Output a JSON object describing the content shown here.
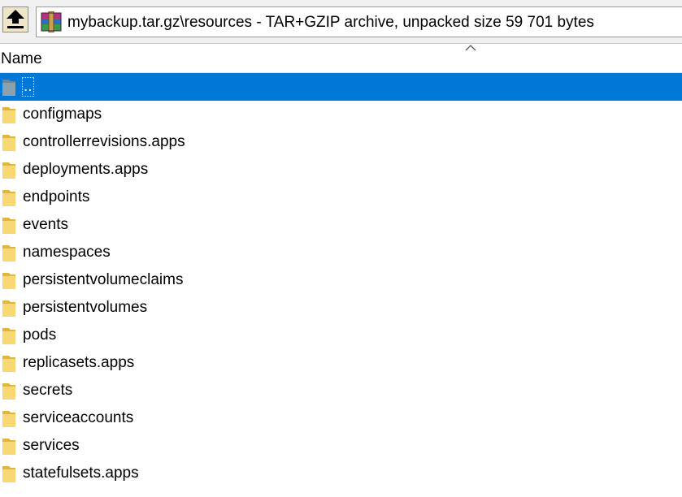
{
  "address_bar": {
    "path_text": "mybackup.tar.gz\\resources - TAR+GZIP archive, unpacked size 59 701 bytes",
    "up_icon": "up-arrow-icon",
    "archive_icon": "winrar-archive-icon"
  },
  "columns": {
    "name_label": "Name",
    "sort_icon": "sort-ascending-caret-icon"
  },
  "items": [
    {
      "label": "..",
      "icon": "parent-folder-icon",
      "selected": true
    },
    {
      "label": "configmaps",
      "icon": "folder-icon",
      "selected": false
    },
    {
      "label": "controllerrevisions.apps",
      "icon": "folder-icon",
      "selected": false
    },
    {
      "label": "deployments.apps",
      "icon": "folder-icon",
      "selected": false
    },
    {
      "label": "endpoints",
      "icon": "folder-icon",
      "selected": false
    },
    {
      "label": "events",
      "icon": "folder-icon",
      "selected": false
    },
    {
      "label": "namespaces",
      "icon": "folder-icon",
      "selected": false
    },
    {
      "label": "persistentvolumeclaims",
      "icon": "folder-icon",
      "selected": false
    },
    {
      "label": "persistentvolumes",
      "icon": "folder-icon",
      "selected": false
    },
    {
      "label": "pods",
      "icon": "folder-icon",
      "selected": false
    },
    {
      "label": "replicasets.apps",
      "icon": "folder-icon",
      "selected": false
    },
    {
      "label": "secrets",
      "icon": "folder-icon",
      "selected": false
    },
    {
      "label": "serviceaccounts",
      "icon": "folder-icon",
      "selected": false
    },
    {
      "label": "services",
      "icon": "folder-icon",
      "selected": false
    },
    {
      "label": "statefulsets.apps",
      "icon": "folder-icon",
      "selected": false
    }
  ],
  "colors": {
    "selection": "#0078d7",
    "folder": "#f8d775",
    "folder_dark": "#e0b640",
    "parent_folder": "#8aa2b0"
  }
}
